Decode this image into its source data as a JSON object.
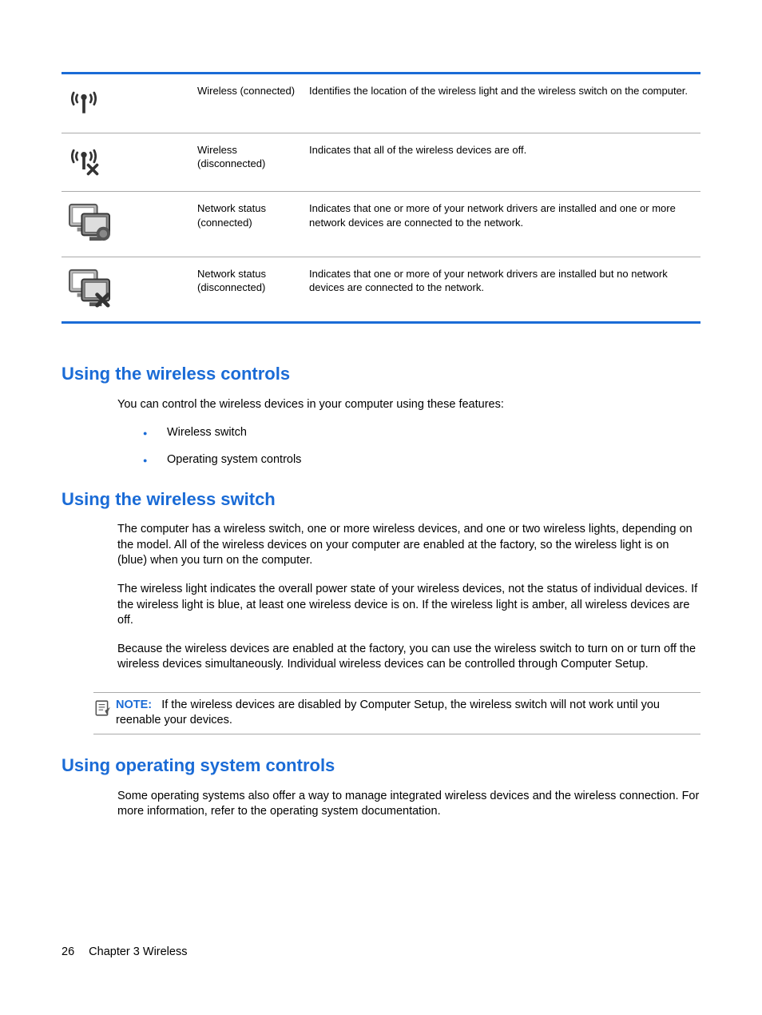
{
  "table": {
    "rows": [
      {
        "label": "Wireless (connected)",
        "desc": "Identifies the location of the wireless light and the wireless switch on the computer."
      },
      {
        "label": "Wireless (disconnected)",
        "desc": "Indicates that all of the wireless devices are off."
      },
      {
        "label": "Network status (connected)",
        "desc": "Indicates that one or more of your network drivers are installed and one or more network devices are connected to the network."
      },
      {
        "label": "Network status (disconnected)",
        "desc": "Indicates that one or more of your network drivers are installed but no network devices are connected to the network."
      }
    ]
  },
  "section1": {
    "heading": "Using the wireless controls",
    "intro": "You can control the wireless devices in your computer using these features:",
    "bullets": [
      "Wireless switch",
      "Operating system controls"
    ]
  },
  "section2": {
    "heading": "Using the wireless switch",
    "p1": "The computer has a wireless switch, one or more wireless devices, and one or two wireless lights, depending on the model. All of the wireless devices on your computer are enabled at the factory, so the wireless light is on (blue) when you turn on the computer.",
    "p2": "The wireless light indicates the overall power state of your wireless devices, not the status of individual devices. If the wireless light is blue, at least one wireless device is on. If the wireless light is amber, all wireless devices are off.",
    "p3": "Because the wireless devices are enabled at the factory, you can use the wireless switch to turn on or turn off the wireless devices simultaneously. Individual wireless devices can be controlled through Computer Setup."
  },
  "note": {
    "label": "NOTE:",
    "text": "If the wireless devices are disabled by Computer Setup, the wireless switch will not work until you reenable your devices."
  },
  "section3": {
    "heading": "Using operating system controls",
    "p1": "Some operating systems also offer a way to manage integrated wireless devices and the wireless connection. For more information, refer to the operating system documentation."
  },
  "footer": {
    "page": "26",
    "chapter": "Chapter 3   Wireless"
  }
}
